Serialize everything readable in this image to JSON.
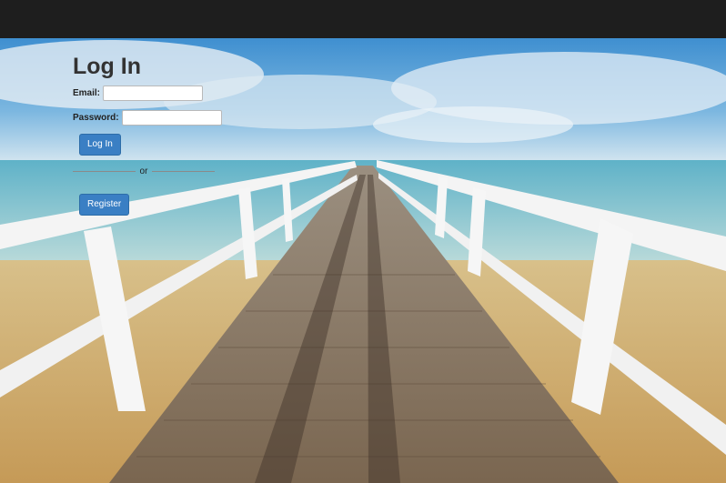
{
  "login": {
    "title": "Log In",
    "email_label": "Email:",
    "email_value": "",
    "password_label": "Password:",
    "password_value": "",
    "login_button": "Log In",
    "divider_text": "or",
    "register_button": "Register"
  },
  "colors": {
    "topbar": "#1e1e1e",
    "button": "#3a7fc4"
  }
}
